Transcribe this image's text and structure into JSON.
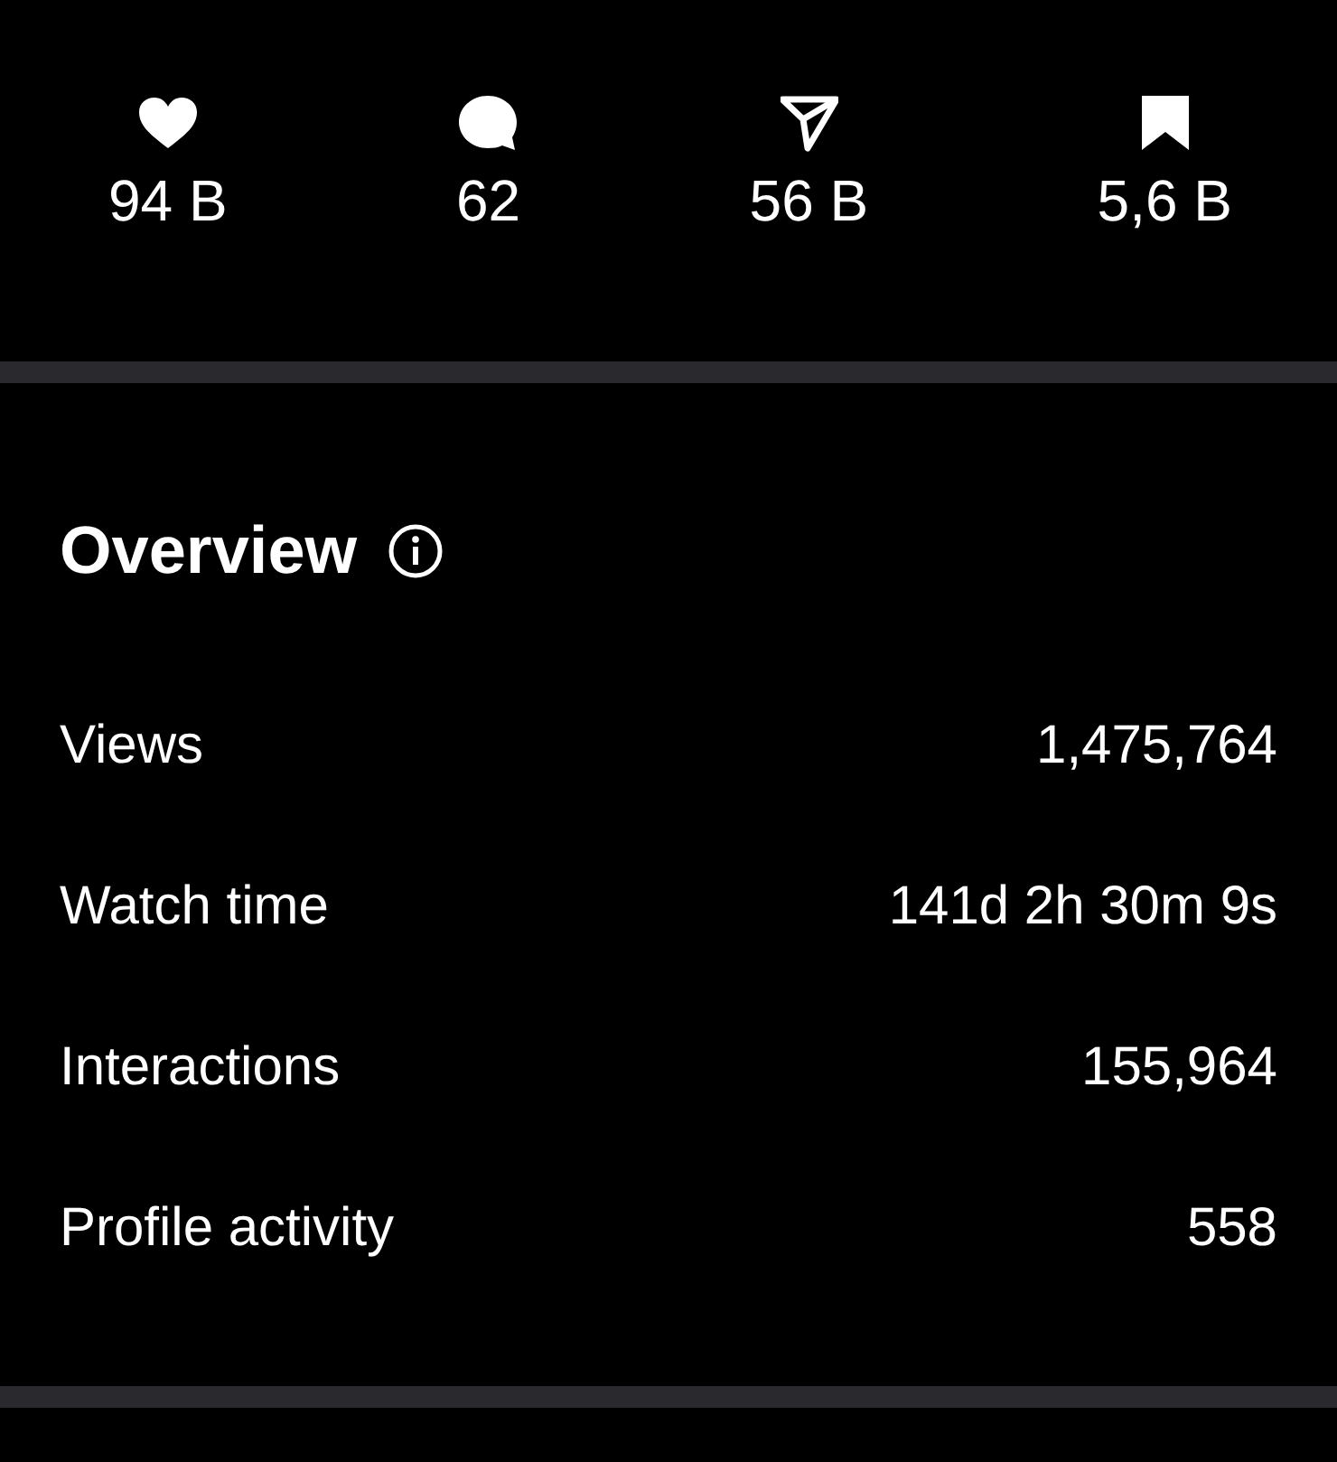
{
  "stats": [
    {
      "kind": "heart",
      "value": "94 B"
    },
    {
      "kind": "comment",
      "value": "62"
    },
    {
      "kind": "send",
      "value": "56 B"
    },
    {
      "kind": "bookmark",
      "value": "5,6 B"
    }
  ],
  "overview": {
    "title": "Overview",
    "rows": [
      {
        "label": "Views",
        "value": "1,475,764"
      },
      {
        "label": "Watch time",
        "value": "141d 2h 30m 9s"
      },
      {
        "label": "Interactions",
        "value": "155,964"
      },
      {
        "label": "Profile activity",
        "value": "558"
      }
    ]
  }
}
